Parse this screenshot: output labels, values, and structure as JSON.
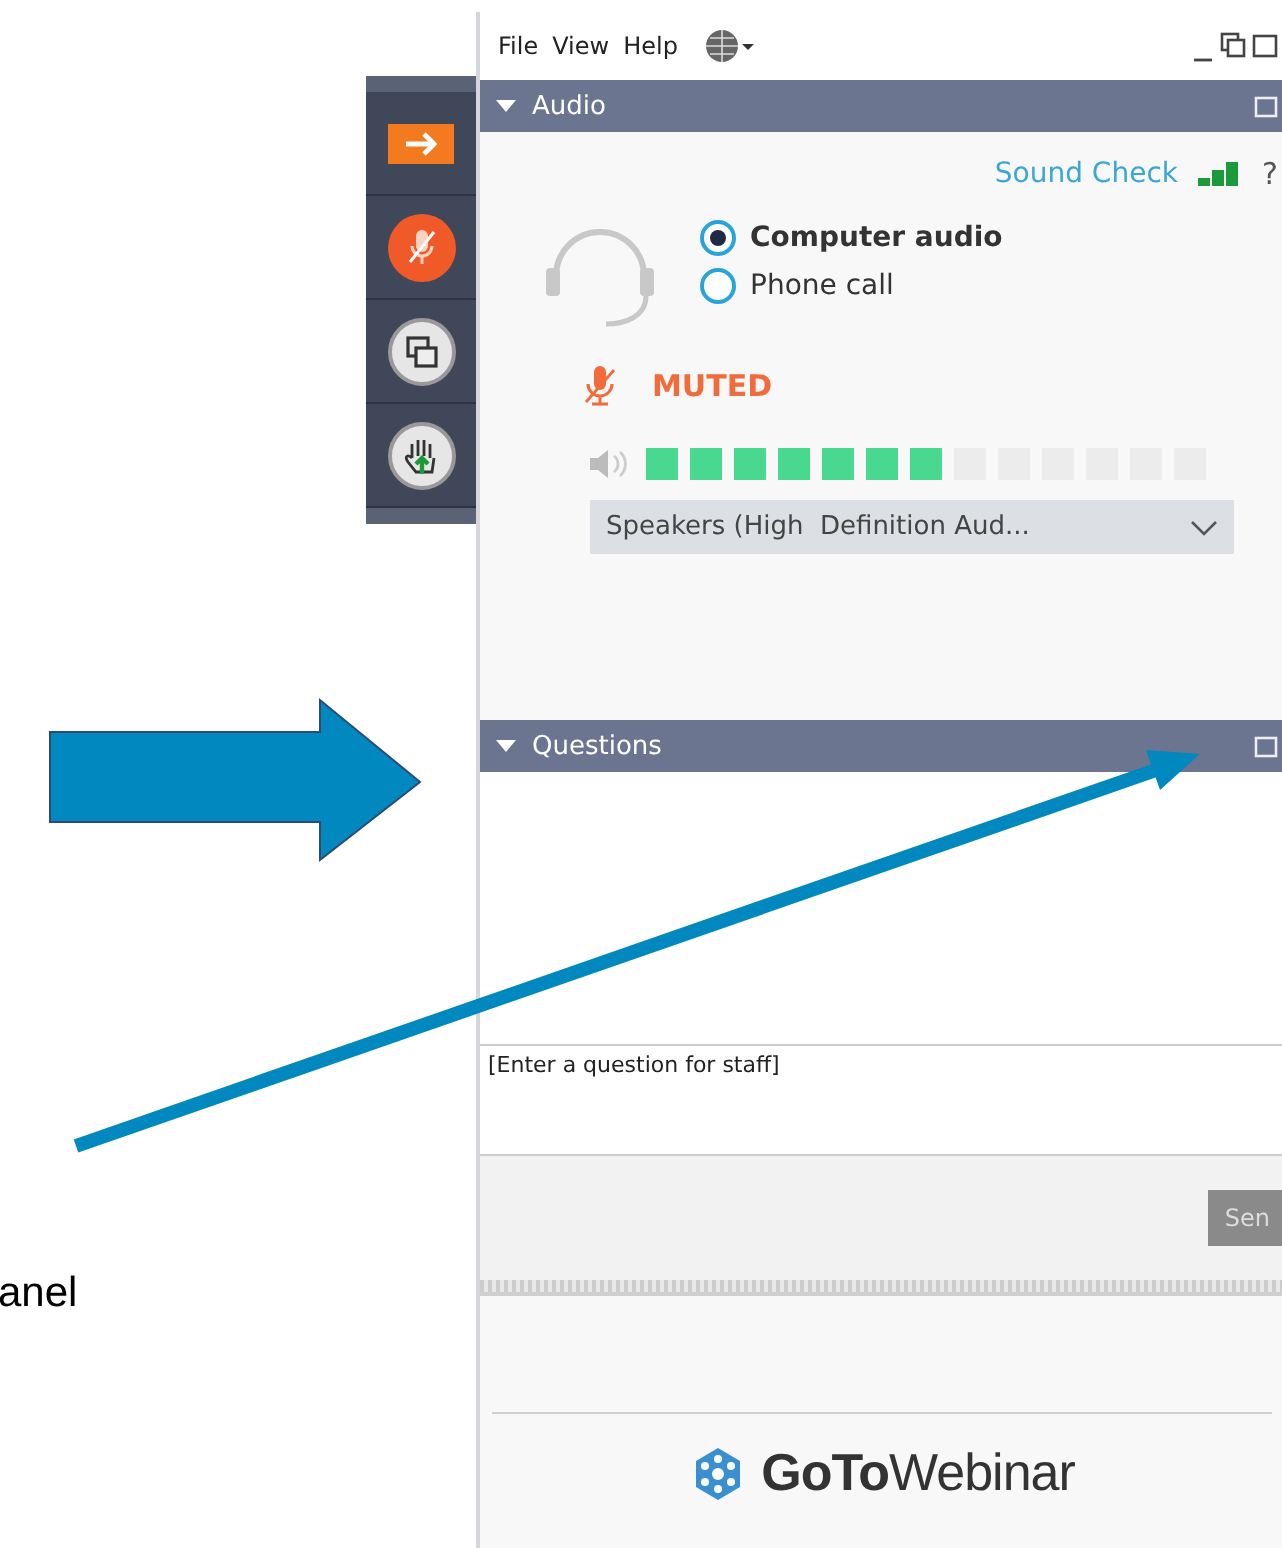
{
  "menu": [
    "File",
    "View",
    "Help"
  ],
  "audio": {
    "title": "Audio",
    "expanded": true,
    "sound_check": "Sound Check",
    "help": "?",
    "options": [
      {
        "label": "Computer audio",
        "selected": true
      },
      {
        "label": "Phone call",
        "selected": false
      }
    ],
    "status": "MUTED",
    "volume": {
      "level": 0.54
    },
    "output_device": "Speakers (High  Definition Aud..."
  },
  "questions": {
    "title": "Questions",
    "expanded": true,
    "placeholder": "[Enter a question for staff]",
    "send_button": "Sen"
  },
  "logo": "**GoTo**Webinar",
  "annotation": "anel"
}
